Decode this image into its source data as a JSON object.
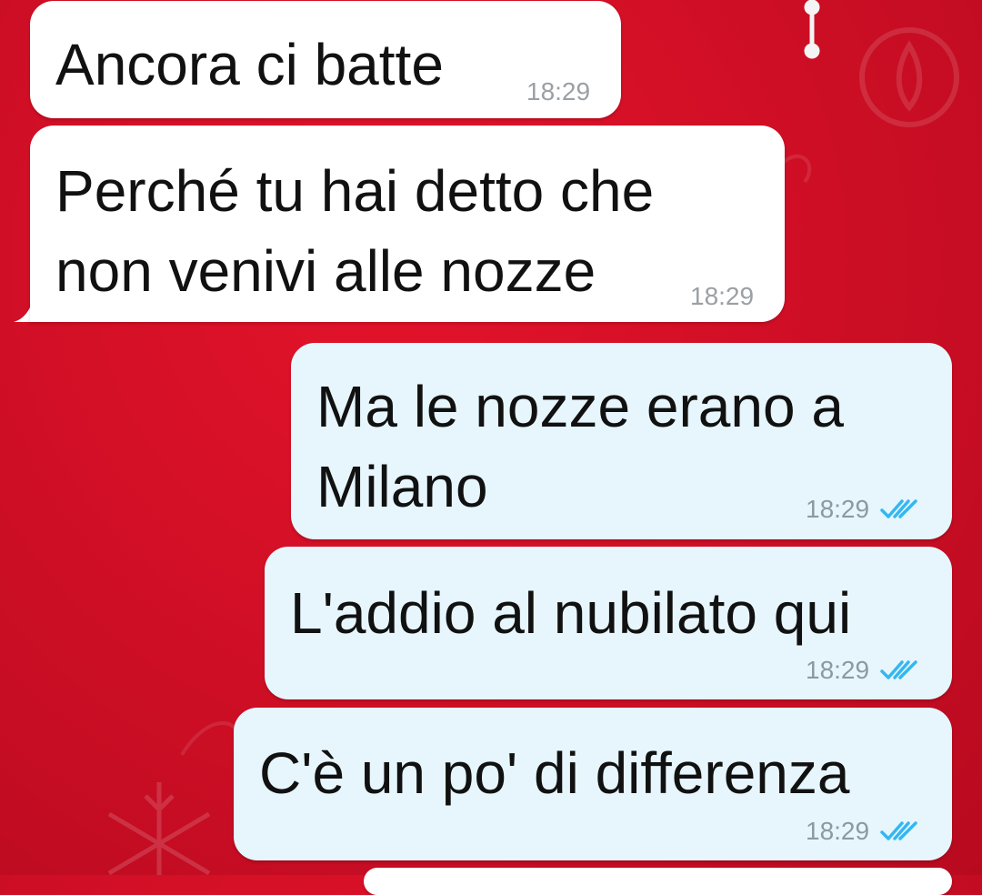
{
  "colors": {
    "background": "#d10f26",
    "incoming_bubble": "#ffffff",
    "outgoing_bubble": "#e6f6fc",
    "read_ticks": "#34b7f1"
  },
  "messages": [
    {
      "direction": "incoming",
      "lines": [
        "Ancora ci batte"
      ],
      "time": "18:29"
    },
    {
      "direction": "incoming",
      "lines": [
        "Perché tu hai detto che",
        "non venivi alle nozze"
      ],
      "time": "18:29"
    },
    {
      "direction": "outgoing",
      "lines": [
        "Ma le nozze erano a",
        "Milano"
      ],
      "time": "18:29",
      "status_icon": "double-check-read-icon"
    },
    {
      "direction": "outgoing",
      "lines": [
        "L'addio al nubilato qui"
      ],
      "time": "18:29",
      "status_icon": "double-check-read-icon"
    },
    {
      "direction": "outgoing",
      "lines": [
        "C'è un po' di differenza"
      ],
      "time": "18:29",
      "status_icon": "double-check-read-icon"
    }
  ]
}
